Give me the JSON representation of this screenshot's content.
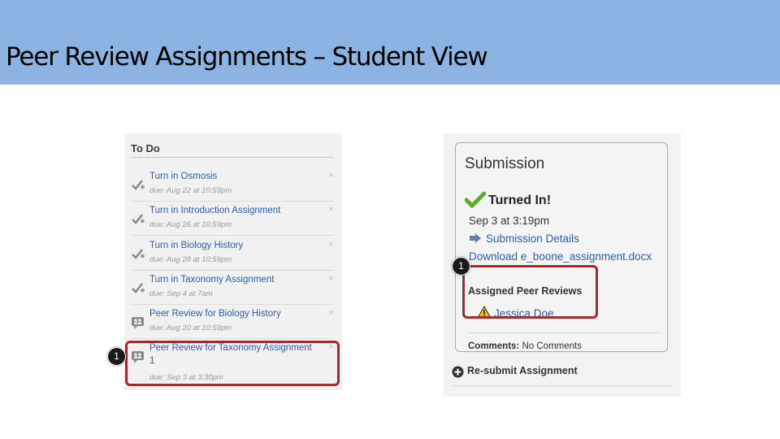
{
  "slide": {
    "title": "Peer Review Assignments – Student View"
  },
  "todo": {
    "heading": "To Do",
    "items": [
      {
        "title": "Turn in Osmosis",
        "due": "due: Aug 22 at 10:59pm",
        "icon": "checkmark-plus-icon"
      },
      {
        "title": "Turn in Introduction Assignment",
        "due": "due: Aug 26 at 10:59pm",
        "icon": "checkmark-plus-icon"
      },
      {
        "title": "Turn in Biology History",
        "due": "due: Aug 28 at 10:59pm",
        "icon": "checkmark-plus-icon"
      },
      {
        "title": "Turn in Taxonomy Assignment",
        "due": "due: Sep 4 at 7am",
        "icon": "checkmark-plus-icon"
      },
      {
        "title": "Peer Review for Biology History",
        "due": "due: Aug 20 at 10:59pm",
        "icon": "peer-review-icon"
      },
      {
        "title": "Peer Review for Taxonomy Assignment",
        "title_line2": "1",
        "due": "due: Sep 3 at 3:30pm",
        "icon": "peer-review-icon"
      }
    ],
    "dismiss_glyph": "×"
  },
  "submission": {
    "heading": "Submission",
    "status": "Turned In!",
    "date": "Sep 3 at 3:19pm",
    "details_link": "Submission Details",
    "download_link": "Download e_boone_assignment.docx",
    "peer_reviews_heading": "Assigned Peer Reviews",
    "peer_reviewer": "Jessica Doe",
    "comments_label": "Comments:",
    "comments_value": "No Comments",
    "resubmit_label": "Re-submit Assignment"
  },
  "callouts": {
    "left": "1",
    "right": "1"
  },
  "colors": {
    "banner": "#8db3e2",
    "link": "#2a5db0",
    "highlight": "#a8262d",
    "check": "#5aaa2a"
  }
}
